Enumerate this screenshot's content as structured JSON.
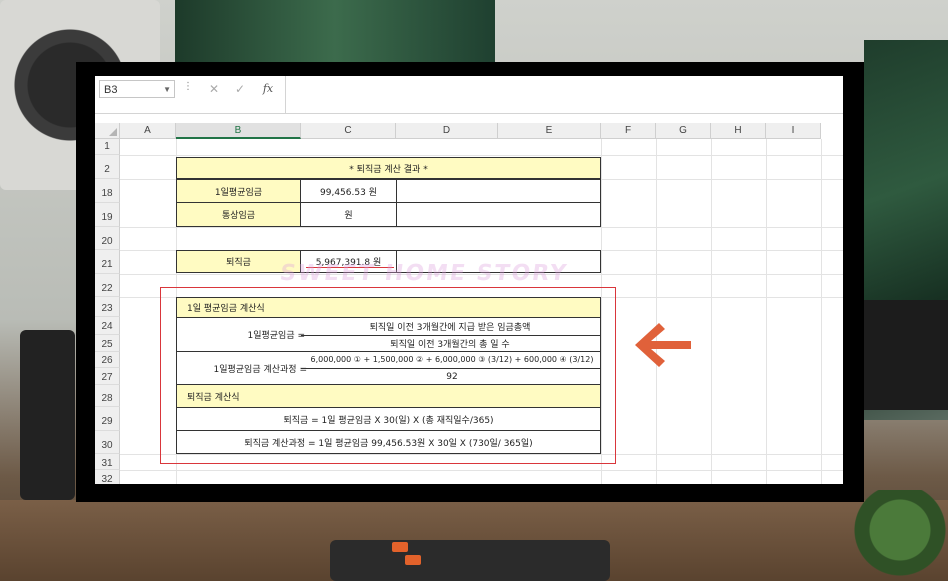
{
  "formula_bar": {
    "name_box": "B3",
    "cancel_icon": "✕",
    "enter_icon": "✓",
    "fx_label": "fx"
  },
  "columns": [
    "A",
    "B",
    "C",
    "D",
    "E",
    "F",
    "G",
    "H",
    "I"
  ],
  "rows": [
    "1",
    "2",
    "18",
    "19",
    "20",
    "21",
    "22",
    "23",
    "24",
    "25",
    "26",
    "27",
    "28",
    "29",
    "30",
    "31",
    "32"
  ],
  "sheet": {
    "title": "* 퇴직금 계산 결과 *",
    "avg_daily_wage_label": "1일평균임금",
    "avg_daily_wage_value": "99,456.53 원",
    "ordinary_wage_label": "통상임금",
    "ordinary_wage_value": "원",
    "severance_label": "퇴직금",
    "severance_value": "5,967,391.8 원",
    "formula_section_title": "1일 평균임금 계산식",
    "avg_wage_formula_label": "1일평균임금 =",
    "avg_wage_numerator": "퇴직일 이전 3개월간에 지급 받은 임금총액",
    "avg_wage_denominator": "퇴직일 이전 3개월간의 총 일 수",
    "avg_wage_process_label": "1일평균임금 계산과정 =",
    "avg_wage_process_numerator": "6,000,000 ① + 1,500,000 ② + 6,000,000 ③ (3/12) + 600,000 ④ (3/12)",
    "avg_wage_process_denominator": "92",
    "severance_section_title": "퇴직금 계산식",
    "severance_formula": "퇴직금 =   1일 평균임금 X 30(일) X (총 재직일수/365)",
    "severance_process": "퇴직금 계산과정 =   1일 평균임금 99,456.53원 X 30일 X (730일/ 365일)"
  },
  "watermark": "SWEET HOME STORY",
  "colors": {
    "highlight_yellow": "#fffbc2",
    "annotation_red": "#d9363b",
    "arrow_orange": "#e0613a",
    "excel_green": "#217346"
  }
}
